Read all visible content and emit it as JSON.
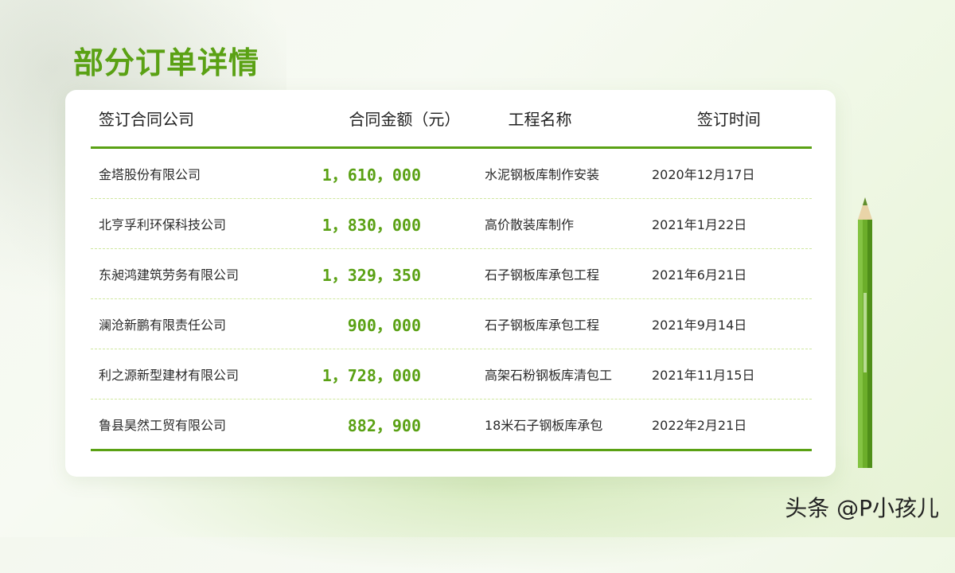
{
  "title": "部分订单详情",
  "table": {
    "headers": [
      "签订合同公司",
      "合同金额（元）",
      "工程名称",
      "签订时间"
    ],
    "rows": [
      {
        "company": "金塔股份有限公司",
        "amount": "1，610，000",
        "project": "水泥钢板库制作安装",
        "date": "2020年12月17日"
      },
      {
        "company": "北亨孚利环保科技公司",
        "amount": "1，830，000",
        "project": "高价散装库制作",
        "date": "2021年1月22日"
      },
      {
        "company": "东昶鸿建筑劳务有限公司",
        "amount": "1，329，350",
        "project": "石子钢板库承包工程",
        "date": "2021年6月21日"
      },
      {
        "company": "澜沧新鹏有限责任公司",
        "amount": "900，000",
        "project": "石子钢板库承包工程",
        "date": "2021年9月14日"
      },
      {
        "company": "利之源新型建材有限公司",
        "amount": "1，728，000",
        "project": "高架石粉钢板库清包工",
        "date": "2021年11月15日"
      },
      {
        "company": "鲁县昊然工贸有限公司",
        "amount": "882，900",
        "project": "18米石子钢板库承包",
        "date": "2022年2月21日"
      }
    ]
  },
  "watermark": "头条 @P小孩儿",
  "colors": {
    "accent": "#5aa114",
    "divider": "#cfe79f",
    "pencil": "#6cae2a"
  },
  "icons": {
    "pencil": "pencil-illustration",
    "leaf_shadow": "leaf-shadow-decoration"
  }
}
